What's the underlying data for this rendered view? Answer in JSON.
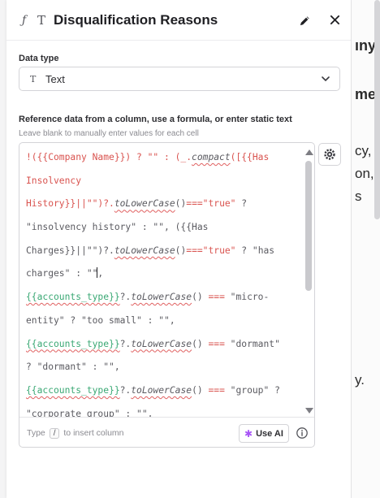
{
  "panel": {
    "title": "Disqualification Reasons",
    "header_icons": {
      "function_glyph": "ƒ",
      "text_glyph": "T"
    }
  },
  "data_type": {
    "label": "Data type",
    "selected_icon_glyph": "T",
    "selected": "Text"
  },
  "reference": {
    "label": "Reference data from a column, use a formula, or enter static text",
    "hint": "Leave blank to manually enter values for each cell"
  },
  "footer": {
    "type_prefix": "Type",
    "type_key": "/",
    "type_suffix": "to insert column",
    "use_ai_label": "Use AI"
  },
  "background_fragments": [
    "ıny",
    "me",
    "cy,",
    "on,",
    "s",
    "y."
  ],
  "colors": {
    "accent_ai": "#a855f7",
    "code_red": "#d9534f",
    "code_green": "#3aa874"
  }
}
